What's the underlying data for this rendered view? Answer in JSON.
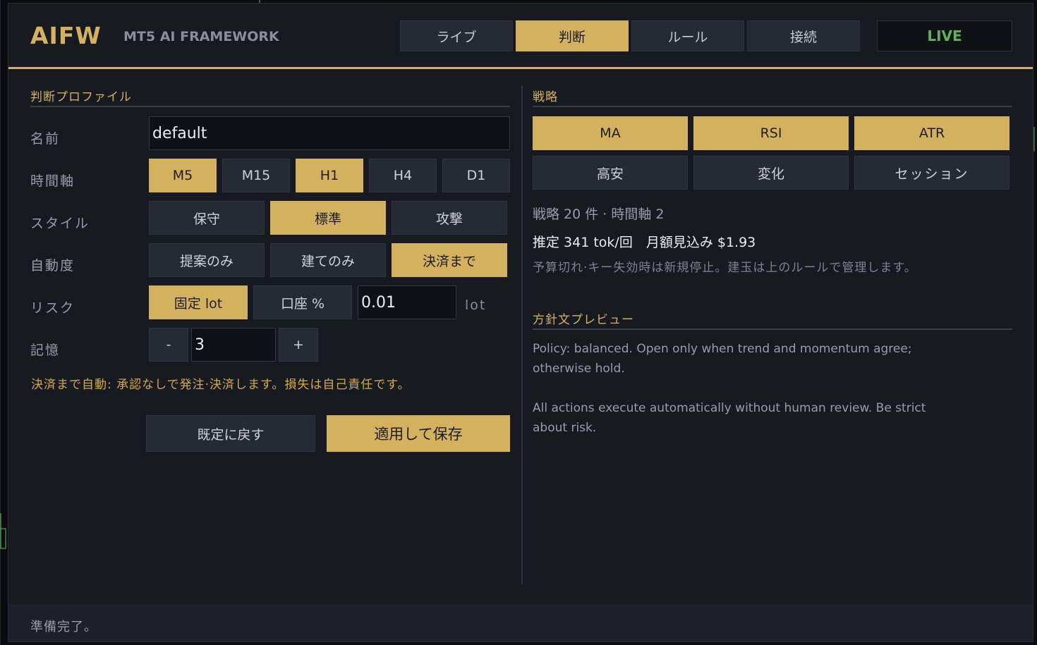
{
  "app": {
    "logo": "AIFW",
    "subtitle": "MT5 AI FRAMEWORK",
    "live_label": "LIVE",
    "tabs": [
      {
        "label": "ライブ",
        "active": false
      },
      {
        "label": "判断",
        "active": true
      },
      {
        "label": "ルール",
        "active": false
      },
      {
        "label": "接続",
        "active": false
      }
    ]
  },
  "profile": {
    "section_title": "判断プロファイル",
    "name_label": "名前",
    "name_value": "default",
    "timeframe_label": "時間軸",
    "timeframes": [
      {
        "label": "M5",
        "on": true
      },
      {
        "label": "M15",
        "on": false
      },
      {
        "label": "H1",
        "on": true
      },
      {
        "label": "H4",
        "on": false
      },
      {
        "label": "D1",
        "on": false
      }
    ],
    "style_label": "スタイル",
    "styles": [
      {
        "label": "保守",
        "on": false
      },
      {
        "label": "標準",
        "on": true
      },
      {
        "label": "攻撃",
        "on": false
      }
    ],
    "autonomy_label": "自動度",
    "autonomy": [
      {
        "label": "提案のみ",
        "on": false
      },
      {
        "label": "建てのみ",
        "on": false
      },
      {
        "label": "決済まで",
        "on": true
      }
    ],
    "risk_label": "リスク",
    "risk_options": [
      {
        "label": "固定 lot",
        "on": true
      },
      {
        "label": "口座 %",
        "on": false
      }
    ],
    "risk_value": "0.01",
    "risk_unit": "lot",
    "memory_label": "記憶",
    "memory_minus": "-",
    "memory_value": "3",
    "memory_plus": "+",
    "warning": "決済まで自動: 承認なしで発注·決済します。損失は自己責任です。",
    "reset_label": "既定に戻す",
    "apply_label": "適用して保存"
  },
  "strategy": {
    "section_title": "戦略",
    "items": [
      {
        "label": "MA",
        "on": true
      },
      {
        "label": "RSI",
        "on": true
      },
      {
        "label": "ATR",
        "on": true
      },
      {
        "label": "高安",
        "on": false
      },
      {
        "label": "変化",
        "on": false
      },
      {
        "label": "セッション",
        "on": false
      }
    ],
    "summary": "戦略 20 件 · 時間軸 2",
    "estimate": "推定 341 tok/回　月額見込み $1.93",
    "note": "予算切れ·キー失効時は新規停止。建玉は上のルールで管理します。"
  },
  "preview": {
    "section_title": "方針文プレビュー",
    "line1": "Policy: balanced. Open only when trend and momentum agree; otherwise hold.",
    "line2": "All actions execute automatically without human review. Be strict about risk."
  },
  "status": {
    "text": "準備完了。"
  },
  "colors": {
    "accent": "#d4b15e",
    "live": "#63b05f",
    "panel": "#171a21"
  }
}
